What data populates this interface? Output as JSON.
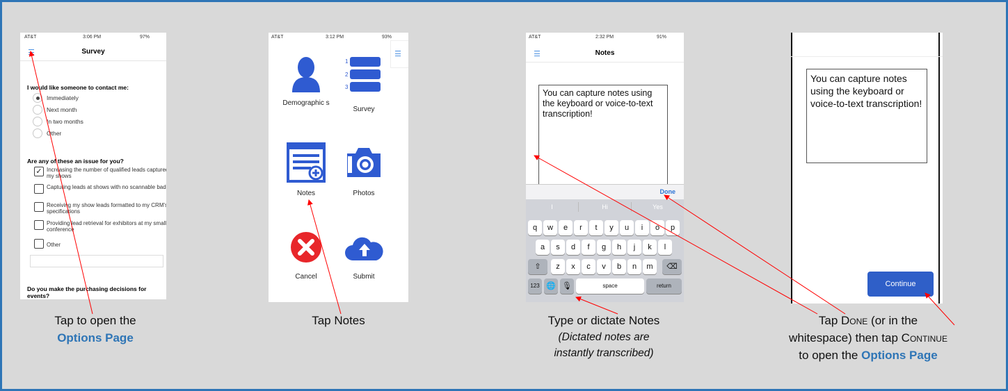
{
  "colors": {
    "frame_border": "#2e75b6",
    "background": "#d9d9d9",
    "link": "#2e75b6",
    "arrow": "#ff0000",
    "icon_blue": "#2f5bd1",
    "cancel_red": "#e8262a"
  },
  "survey_screen": {
    "status": {
      "carrier": "AT&T",
      "time": "3:06 PM",
      "battery": "97%"
    },
    "title": "Survey",
    "menu_icon": "hamburger-icon",
    "question1": "I would like someone to contact me:",
    "radio_options": [
      "Immediately",
      "Next month",
      "In two months",
      "Other"
    ],
    "selected_radio": "Immediately",
    "question2": "Are any of these an issue for you?",
    "checkbox_options": [
      {
        "label": "Increasing the number of qualified leads captured at my shows",
        "checked": true
      },
      {
        "label": "Capturing leads at shows with no scannable badges",
        "checked": false
      },
      {
        "label": "Receiving my show leads formatted to my CRM's specifications",
        "checked": false
      },
      {
        "label": "Providing lead retrieval for exhibitors at my small conference",
        "checked": false
      },
      {
        "label": "Other",
        "checked": false
      }
    ],
    "question3": "Do you make the purchasing decisions for events?"
  },
  "options_screen": {
    "status": {
      "carrier": "AT&T",
      "time": "3:12 PM",
      "battery": "93%"
    },
    "menu_icon": "hamburger-icon",
    "tiles": [
      {
        "label": "Demographic s",
        "icon": "person-icon"
      },
      {
        "label": "Survey",
        "icon": "numbered-list-icon"
      },
      {
        "label": "Notes",
        "icon": "notes-add-icon"
      },
      {
        "label": "Photos",
        "icon": "camera-icon"
      },
      {
        "label": "Cancel",
        "icon": "cancel-x-icon"
      },
      {
        "label": "Submit",
        "icon": "cloud-upload-icon"
      }
    ]
  },
  "notes_keyboard_screen": {
    "status": {
      "carrier": "AT&T",
      "time": "2:32 PM",
      "battery": "91%"
    },
    "title": "Notes",
    "note_text": "You can capture notes using the keyboard or voice-to-text transcription!",
    "done_label": "Done",
    "suggestions": [
      "I",
      "Hi",
      "Yes"
    ],
    "keyboard_rows": [
      [
        "q",
        "w",
        "e",
        "r",
        "t",
        "y",
        "u",
        "i",
        "o",
        "p"
      ],
      [
        "a",
        "s",
        "d",
        "f",
        "g",
        "h",
        "j",
        "k",
        "l"
      ],
      [
        "z",
        "x",
        "c",
        "v",
        "b",
        "n",
        "m"
      ]
    ],
    "numbers_key": "123",
    "space_key": "space",
    "return_key": "return"
  },
  "notes_done_screen": {
    "note_text": "You can capture notes using the keyboard or voice-to-text transcription!",
    "continue_label": "Continue"
  },
  "captions": {
    "c1_line1": "Tap to open the",
    "c1_link": "Options Page",
    "c2": "Tap Notes",
    "c3_line1": "Type or dictate Notes",
    "c3_line2": "(Dictated notes are",
    "c3_line3": "instantly transcribed)",
    "c4_part1": "Tap",
    "c4_done": "Done",
    "c4_part2": "(or in the",
    "c4_part3": "whitespace) then tap",
    "c4_continue": "Continue",
    "c4_part4": "to open the",
    "c4_link": "Options Page"
  }
}
